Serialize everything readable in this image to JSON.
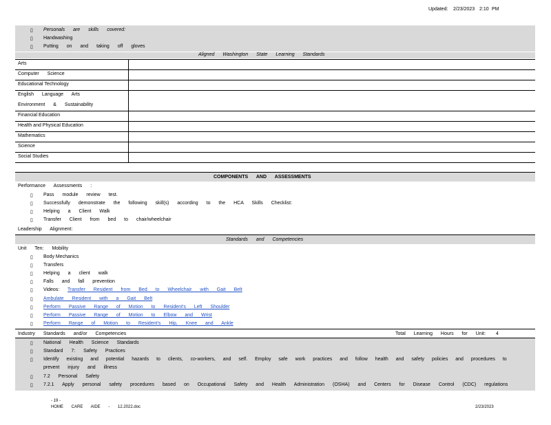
{
  "header": {
    "updated_label": "Updated:",
    "date": "2/23/2023",
    "time": "2:10",
    "ampm": "PM"
  },
  "bullet_glyph": "▯",
  "skills_top": [
    "Personals are skills covered:",
    "Handwashing",
    "Putting on and taking off gloves"
  ],
  "aligned_header": "Aligned Washington State Learning Standards",
  "subjects": [
    "Arts",
    "Computer Science",
    "Educational Technology",
    "English Language Arts",
    "Environment & Sustainability",
    "Financial Education",
    "Health and Physical Education",
    "Mathematics",
    "Science",
    "Social Studies"
  ],
  "components_header": "COMPONENTS AND ASSESSMENTS",
  "performance": {
    "label": "Performance Assessments :",
    "items": [
      "Pass module review test.",
      "Successfully demonstrate the following skill(s) according to the HCA Skills Checklist:",
      "Helping a Client Walk",
      "Transfer Client from bed to chair/wheelchair"
    ]
  },
  "leadership": "Leadership Alignment:",
  "standards_header": "Standards and Competencies",
  "unit": {
    "label": "Unit Ten: Mobility",
    "items": [
      "Body Mechanics",
      "Transfers",
      "Helping a client walk",
      "Falls and fall prevention",
      "Videos:"
    ],
    "video_link": "Transfer Resident from Bed to Wheelchair with Gait Belt",
    "links": [
      "Ambulate Resident with a Gait Belt",
      "Perform Passive Range of Motion to Resident's Left Shoulder",
      "Perform Passive Range of Motion to Elbow and Wrist",
      "Perform Range of Motion to Resident's Hip, Knee and Ankle"
    ]
  },
  "industry": {
    "label": "Industry Standards and/or Competencies",
    "hours_label": "Total Learning Hours for Unit:",
    "hours": "4"
  },
  "industry_items": [
    "National Health Science Standards",
    "Standard 7: Safety Practices",
    "Identify existing and potential hazards to clients, co-workers, and self. Employ safe work practices and follow health and safety policies and procedures to",
    "prevent injury and illness",
    "7.2 Personal Safety",
    "7.2.1 Apply personal safety procedures based on Occupational Safety and Health Administration (OSHA) and Centers for Disease Control (CDC) regulations"
  ],
  "footer": {
    "page": "- 19 -",
    "doc": "HOME CARE AIDE - 12.2022.doc",
    "date": "2/23/2023"
  }
}
